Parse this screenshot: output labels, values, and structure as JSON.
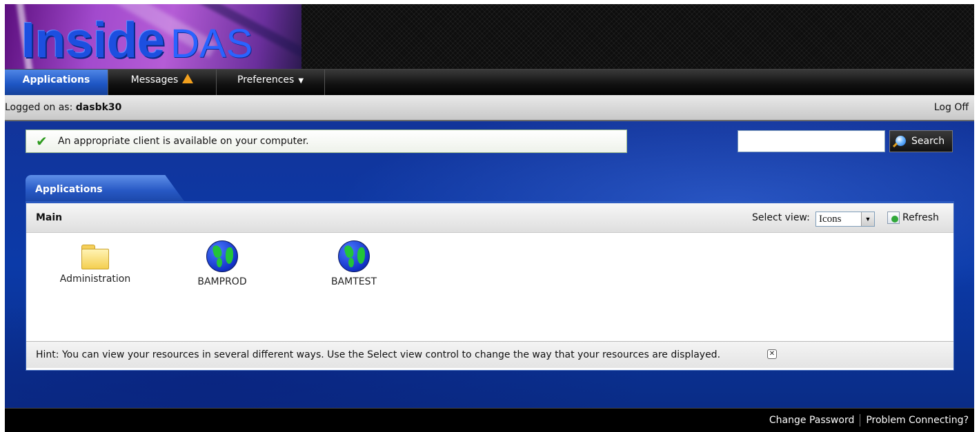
{
  "logo": {
    "part1": "Inside",
    "part2": "DAS"
  },
  "nav": {
    "applications": "Applications",
    "messages": "Messages",
    "preferences": "Preferences"
  },
  "userbar": {
    "logged_on_label": "Logged on as:",
    "username": "dasbk30",
    "log_off": "Log Off"
  },
  "client_status": {
    "message": "An appropriate client is available on your computer."
  },
  "search": {
    "value": "",
    "button_label": "Search"
  },
  "apps_panel": {
    "tab_label": "Applications",
    "section_title": "Main",
    "select_view_label": "Select view:",
    "selected_view": "Icons",
    "refresh_label": "Refresh",
    "resources": [
      {
        "label": "Administration",
        "icon": "folder-icon"
      },
      {
        "label": "BAMPROD",
        "icon": "globe-icon"
      },
      {
        "label": "BAMTEST",
        "icon": "globe-icon"
      }
    ],
    "hint": "Hint: You can view your resources in several different ways. Use the Select view control to change the way that your resources are displayed."
  },
  "footer": {
    "change_password": "Change Password",
    "problem_connecting": "Problem Connecting?"
  },
  "colors": {
    "brand_blue": "#1c4fe0",
    "active_tab": "#1e56c4",
    "background_blue": "#0b3aa8",
    "success_green": "#2e9b1f",
    "warning_orange": "#f2a01e"
  }
}
